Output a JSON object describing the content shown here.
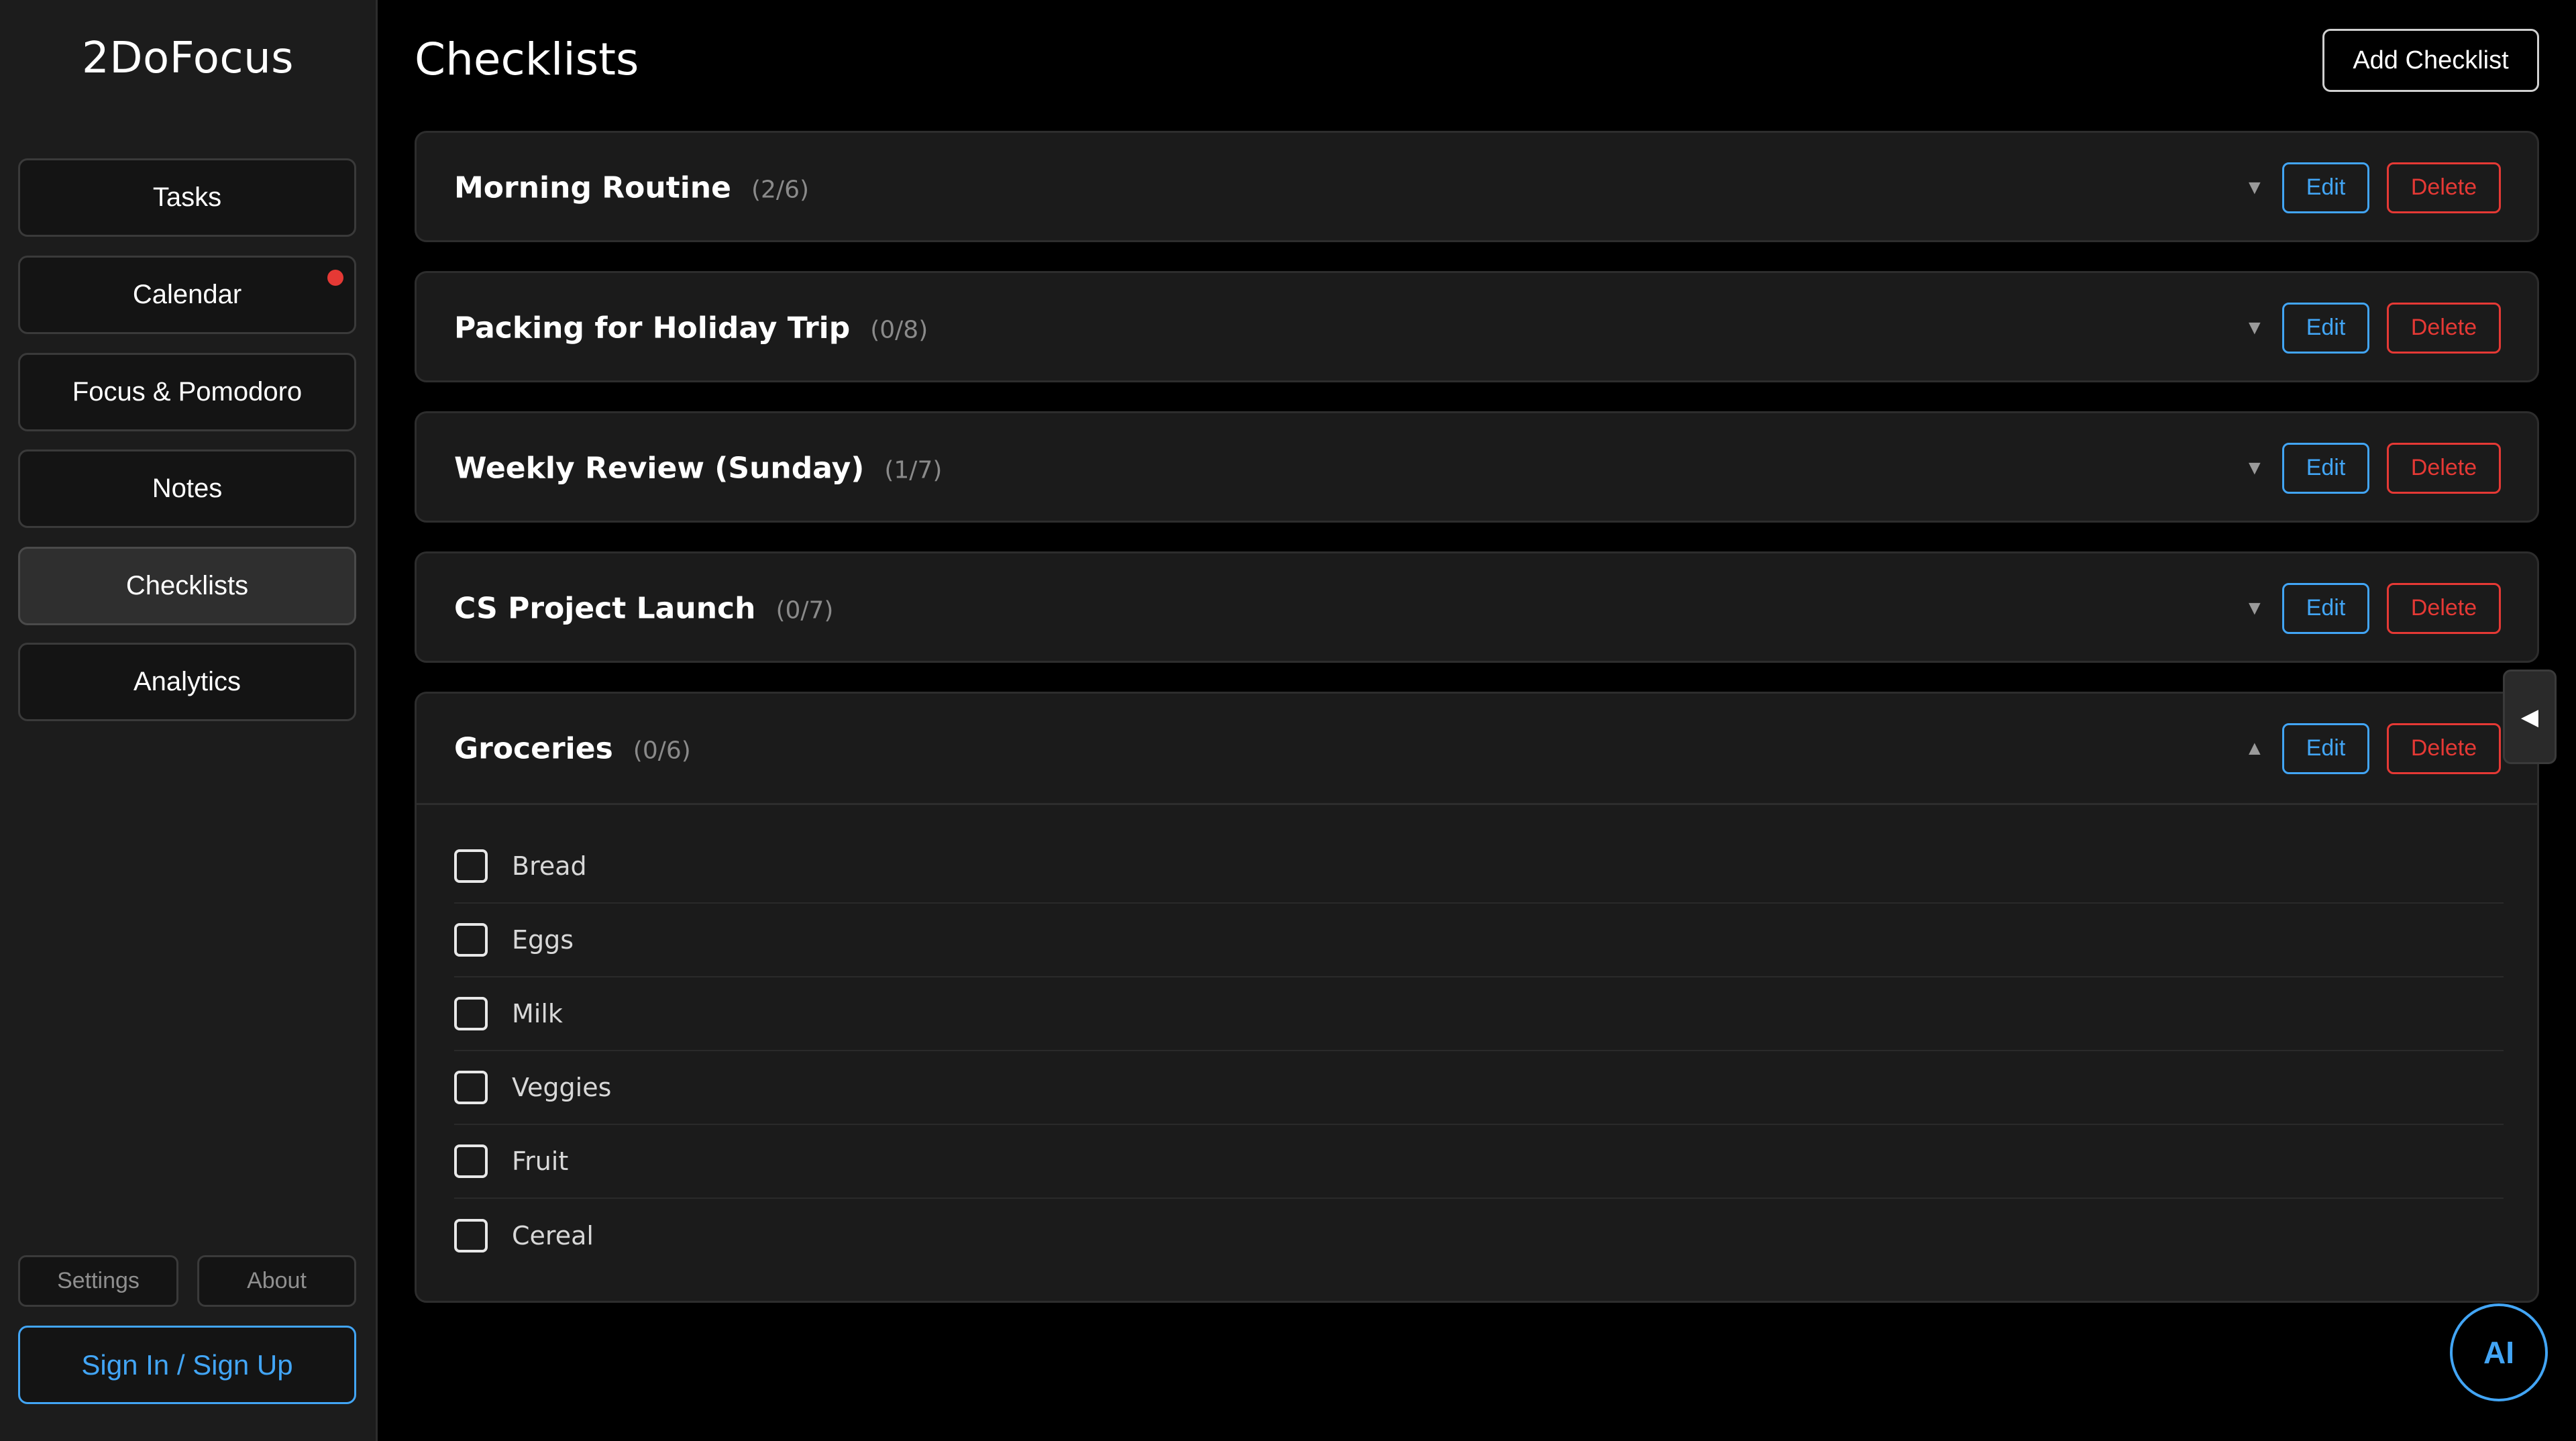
{
  "app": {
    "title": "2DoFocus"
  },
  "sidebar": {
    "items": [
      {
        "label": "Tasks"
      },
      {
        "label": "Calendar",
        "has_notification": true
      },
      {
        "label": "Focus & Pomodoro"
      },
      {
        "label": "Notes"
      },
      {
        "label": "Checklists",
        "active": true
      },
      {
        "label": "Analytics"
      }
    ],
    "settings_label": "Settings",
    "about_label": "About",
    "signin_label": "Sign In / Sign Up"
  },
  "header": {
    "title": "Checklists",
    "add_label": "Add Checklist"
  },
  "checklists": [
    {
      "name": "Morning Routine",
      "count": "(2/6)",
      "expanded": false
    },
    {
      "name": "Packing for Holiday Trip",
      "count": "(0/8)",
      "expanded": false
    },
    {
      "name": "Weekly Review (Sunday)",
      "count": "(1/7)",
      "expanded": false
    },
    {
      "name": "CS Project Launch",
      "count": "(0/7)",
      "expanded": false
    },
    {
      "name": "Groceries",
      "count": "(0/6)",
      "expanded": true,
      "items": [
        {
          "label": "Bread",
          "checked": false
        },
        {
          "label": "Eggs",
          "checked": false
        },
        {
          "label": "Milk",
          "checked": false
        },
        {
          "label": "Veggies",
          "checked": false
        },
        {
          "label": "Fruit",
          "checked": false
        },
        {
          "label": "Cereal",
          "checked": false
        }
      ]
    }
  ],
  "actions": {
    "edit_label": "Edit",
    "delete_label": "Delete"
  },
  "icons": {
    "collapsed": "triangle-down-icon",
    "expanded": "triangle-up-icon",
    "panel_toggle": "triangle-left-icon"
  },
  "ai_button": {
    "label": "AI"
  },
  "colors": {
    "accent": "#42a5f5",
    "danger": "#e53935",
    "notification": "#e53935",
    "background": "#000000",
    "sidebar": "#1c1c1c",
    "card": "#1b1b1b"
  }
}
